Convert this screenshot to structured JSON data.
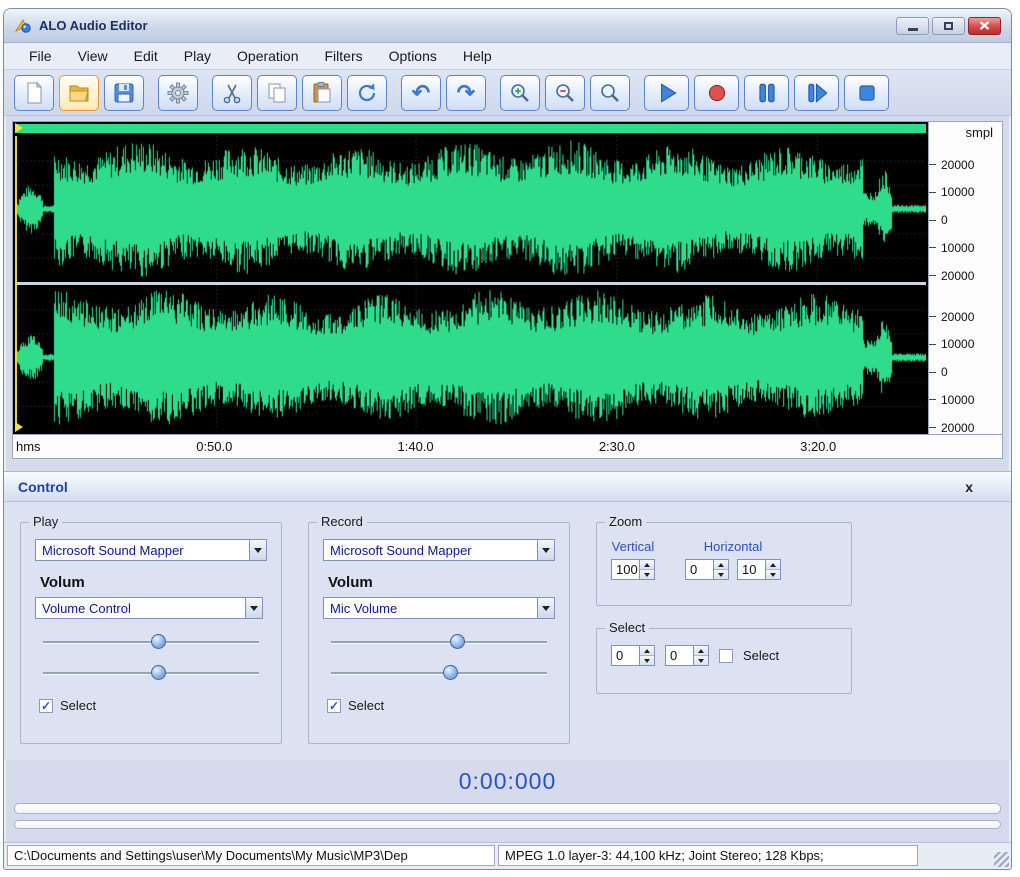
{
  "window": {
    "title": "ALO Audio Editor",
    "control_icons": [
      "minimize-icon",
      "maximize-icon",
      "close-icon"
    ]
  },
  "menu": {
    "items": [
      "File",
      "View",
      "Edit",
      "Play",
      "Operation",
      "Filters",
      "Options",
      "Help"
    ]
  },
  "toolbar": {
    "buttons": [
      "new",
      "open",
      "save",
      "settings",
      "cut",
      "copy",
      "paste",
      "refresh",
      "undo",
      "redo",
      "zoom-in",
      "zoom-out",
      "zoom",
      "play",
      "record",
      "pause",
      "step-forward",
      "stop"
    ],
    "glyphs": {
      "undo": "↶",
      "redo": "↷"
    }
  },
  "waveform": {
    "unit_label": "smpl",
    "channel1_ticks": [
      "20000",
      "10000",
      "0",
      "10000",
      "20000"
    ],
    "channel2_ticks": [
      "20000",
      "10000",
      "0",
      "10000",
      "20000"
    ],
    "time_axis_label": "hms",
    "time_ticks": [
      "0:50.0",
      "1:40.0",
      "2:30.0",
      "3:20.0"
    ]
  },
  "control": {
    "title": "Control",
    "close_label": "x",
    "play": {
      "group_label": "Play",
      "device": "Microsoft Sound Mapper",
      "volume_label": "Volum",
      "volume_device": "Volume Control",
      "select_label": "Select",
      "select_check": "✓"
    },
    "record": {
      "group_label": "Record",
      "device": "Microsoft Sound Mapper",
      "volume_label": "Volum",
      "volume_device": "Mic Volume",
      "select_label": "Select",
      "select_check": "✓"
    },
    "zoom": {
      "group_label": "Zoom",
      "vertical_label": "Vertical",
      "vertical_value": "100",
      "horizontal_label": "Horizontal",
      "horizontal_value1": "0",
      "horizontal_value2": "10"
    },
    "select": {
      "group_label": "Select",
      "value1": "0",
      "value2": "0",
      "checkbox_label": "Select",
      "select_check": ""
    }
  },
  "time_display": "0:00:000",
  "status": {
    "file_path": "C:\\Documents and Settings\\user\\My Documents\\My Music\\MP3\\Dep",
    "format_info": "MPEG 1.0 layer-3: 44,100 kHz; Joint Stereo; 128 Kbps;"
  },
  "colors": {
    "waveform_green": "#2EDC8C",
    "accent_blue": "#2B50C8",
    "record_red": "#D84040",
    "window_bg": "#D5DBEC"
  }
}
